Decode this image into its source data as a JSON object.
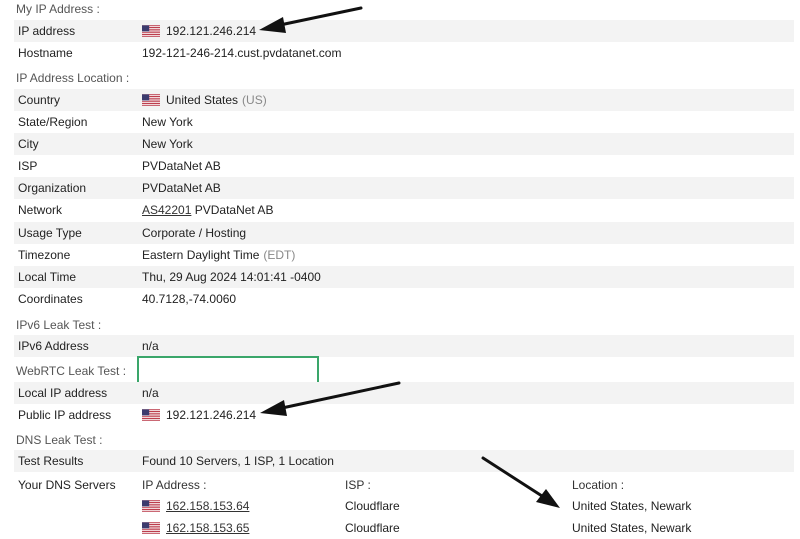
{
  "colors": {
    "row_shade": "#f3f3f3",
    "webrtc_border": "#3aa66a",
    "arrow": "#111111"
  },
  "my_ip": {
    "section_title": "My IP Address :",
    "ip_label": "IP address",
    "ip_value": "192.121.246.214",
    "ip_flag_icon": "us-flag-icon",
    "hostname_label": "Hostname",
    "hostname_value": "192-121-246-214.cust.pvdatanet.com"
  },
  "location": {
    "section_title": "IP Address Location :",
    "country_label": "Country",
    "country_value": "United States",
    "country_code": "(US)",
    "state_label": "State/Region",
    "state_value": "New York",
    "city_label": "City",
    "city_value": "New York",
    "isp_label": "ISP",
    "isp_value": "PVDataNet AB",
    "org_label": "Organization",
    "org_value": "PVDataNet AB",
    "network_label": "Network",
    "network_asn": "AS42201",
    "network_name": "PVDataNet AB",
    "usage_label": "Usage Type",
    "usage_value": "Corporate / Hosting",
    "timezone_label": "Timezone",
    "timezone_value": "Eastern Daylight Time",
    "timezone_abbr": "(EDT)",
    "localtime_label": "Local Time",
    "localtime_value": "Thu, 29 Aug 2024 14:01:41 -0400",
    "coords_label": "Coordinates",
    "coords_value": "40.7128,-74.0060"
  },
  "ipv6": {
    "section_title": "IPv6 Leak Test :",
    "address_label": "IPv6 Address",
    "address_value": "n/a"
  },
  "webrtc": {
    "section_title": "WebRTC Leak Test :",
    "local_label": "Local IP address",
    "local_value": "n/a",
    "public_label": "Public IP address",
    "public_value": "192.121.246.214"
  },
  "dns": {
    "section_title": "DNS Leak Test :",
    "results_label": "Test Results",
    "results_value": "Found 10 Servers, 1 ISP, 1 Location",
    "servers_label": "Your DNS Servers",
    "col_ip": "IP Address :",
    "col_isp": "ISP :",
    "col_location": "Location :",
    "servers": [
      {
        "ip": "162.158.153.64",
        "isp": "Cloudflare",
        "location": "United States, Newark"
      },
      {
        "ip": "162.158.153.65",
        "isp": "Cloudflare",
        "location": "United States, Newark"
      }
    ]
  }
}
